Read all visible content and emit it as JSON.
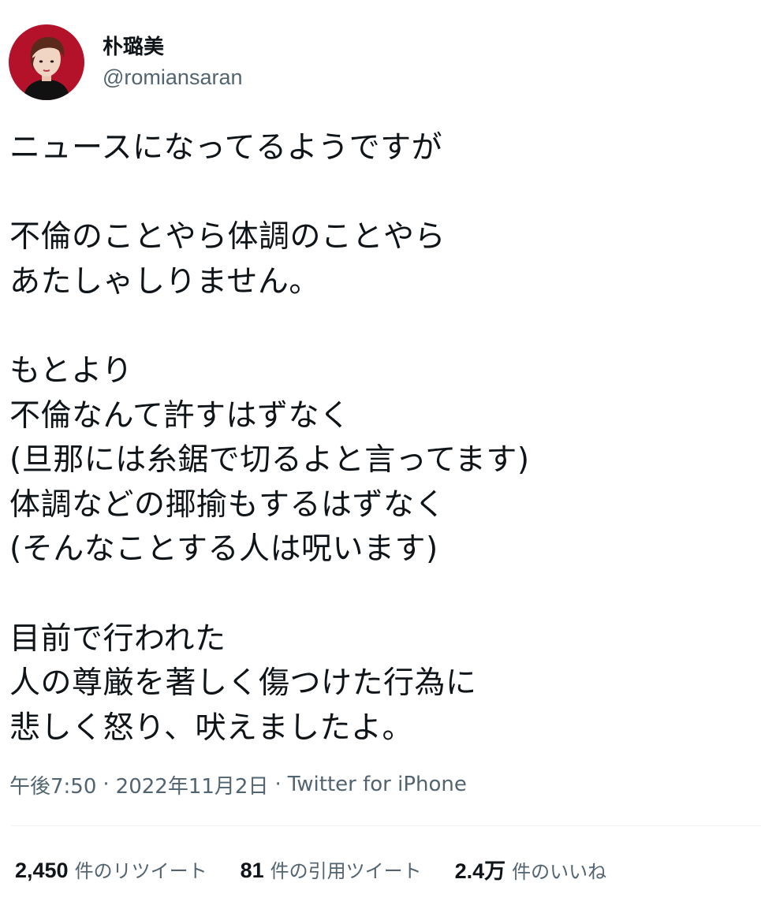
{
  "author": {
    "display_name": "朴璐美",
    "handle": "@romiansaran"
  },
  "tweet": {
    "lines": [
      "ニュースになってるようですが",
      "",
      "不倫のことやら体調のことやら",
      "あたしゃしりません。",
      "",
      "もとより",
      "不倫なんて許すはずなく",
      "(旦那には糸鋸で切るよと言ってます)",
      "体調などの揶揄もするはずなく",
      "(そんなことする人は呪います)",
      "",
      "目前で行われた",
      "人の尊厳を著しく傷つけた行為に",
      "悲しく怒り、吠えましたよ。"
    ]
  },
  "meta": {
    "time": "午後7:50",
    "date": "2022年11月2日",
    "separator": "·",
    "source": "Twitter for iPhone"
  },
  "stats": {
    "retweets": {
      "count": "2,450",
      "label": "件のリツイート"
    },
    "quotes": {
      "count": "81",
      "label": "件の引用ツイート"
    },
    "likes": {
      "count": "2.4万",
      "label": "件のいいね"
    }
  },
  "colors": {
    "avatar_background": "#b3122a",
    "text_primary": "#0f1419",
    "text_secondary": "#536471",
    "divider": "#eff3f4"
  }
}
